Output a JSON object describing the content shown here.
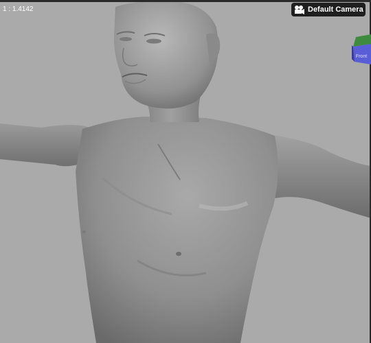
{
  "viewport": {
    "aspect_ratio_label": "1 : 1.4142",
    "camera": {
      "label": "Default Camera",
      "icon": "video-camera-icon"
    },
    "view_cube": {
      "face_label": "Front",
      "colors": {
        "top": "#3e8a3e",
        "front": "#5a5ed6",
        "side": "#3a3a9a"
      }
    },
    "background_color": "#aaaaaa"
  }
}
